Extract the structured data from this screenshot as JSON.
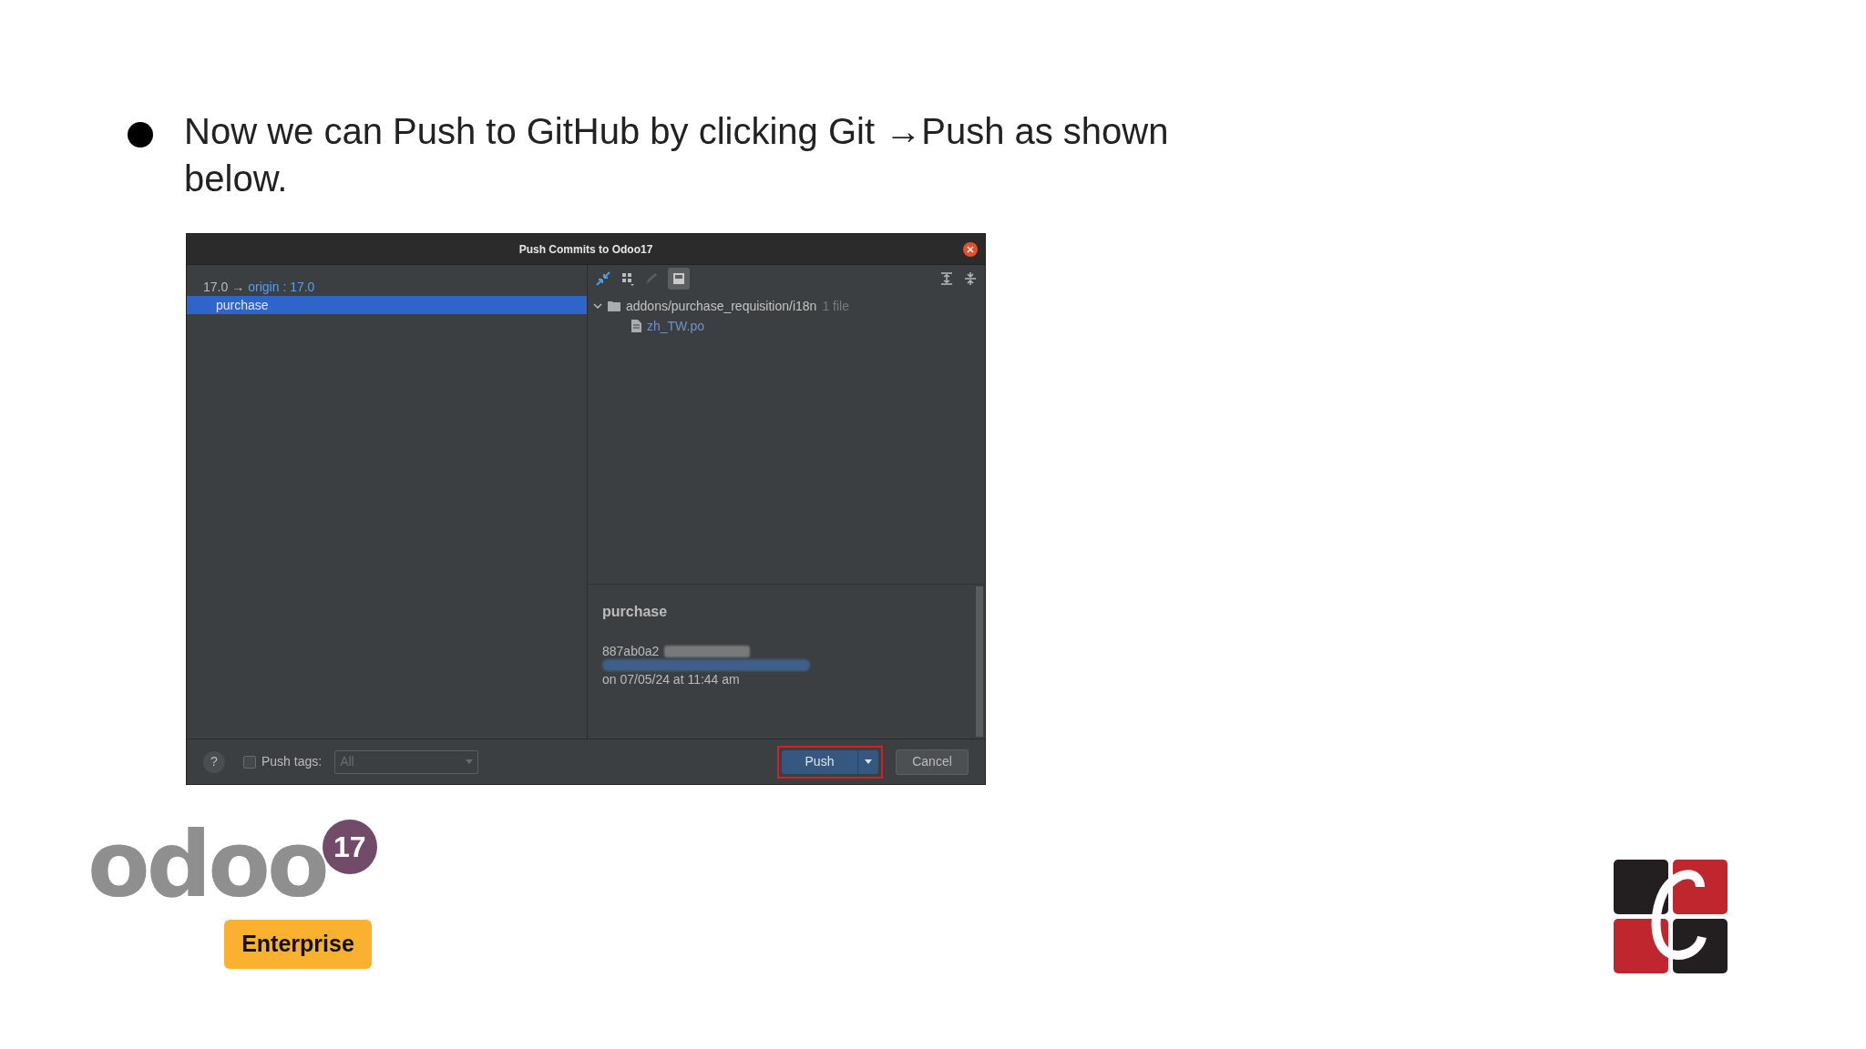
{
  "bullet": "Now we can Push to GitHub by clicking Git →Push as shown below.",
  "dialog": {
    "title": "Push Commits to Odoo17",
    "branch": {
      "local": "17.0",
      "arrow": "→",
      "remote": "origin : 17.0"
    },
    "commits": [
      {
        "label": "purchase",
        "selected": true
      }
    ],
    "tree": [
      {
        "label": "addons/purchase_requisition/i18n",
        "count": "1 file",
        "expanded": true,
        "children": [
          {
            "label": "zh_TW.po"
          }
        ]
      }
    ],
    "details": {
      "subject": "purchase",
      "hash": "887ab0a2",
      "date": "on 07/05/24 at 11:44 am"
    },
    "help": "?",
    "push_tags": {
      "label": "Push tags:",
      "checked": false,
      "value": "All"
    },
    "buttons": {
      "push": "Push",
      "cancel": "Cancel"
    }
  },
  "logo": {
    "word": "odoo",
    "version": "17",
    "edition": "Enterprise"
  }
}
